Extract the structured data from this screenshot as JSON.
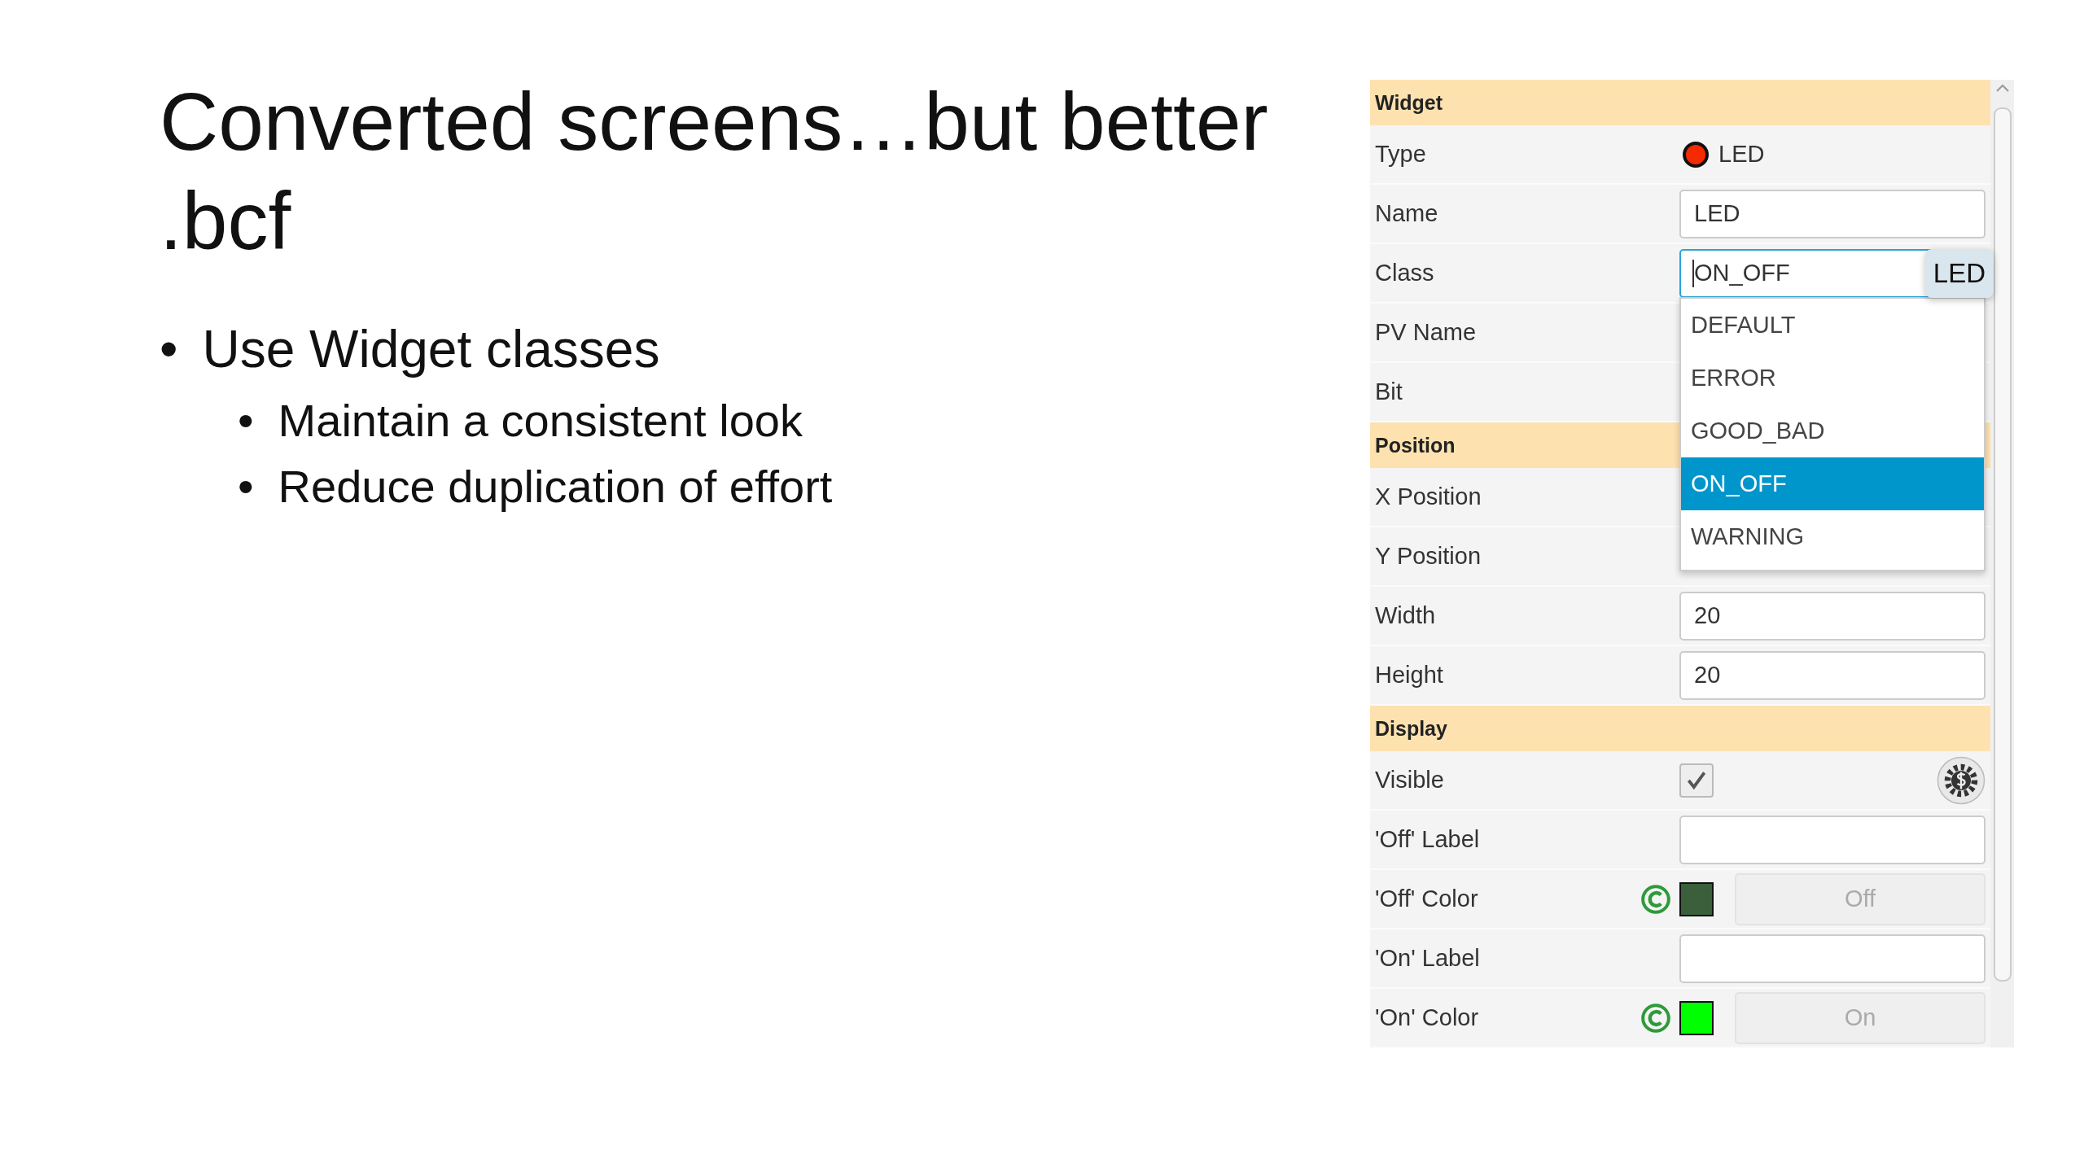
{
  "slide": {
    "title": "Converted screens…but better .bcf",
    "bullets": [
      {
        "marker": "•",
        "text": "Use Widget classes",
        "children": [
          {
            "marker": "•",
            "text": "Maintain a consistent look"
          },
          {
            "marker": "•",
            "text": "Reduce duplication of effort"
          }
        ]
      }
    ]
  },
  "properties": {
    "sections": [
      {
        "title": "Widget",
        "rows": [
          {
            "label": "Type",
            "kind": "type",
            "value": "LED"
          },
          {
            "label": "Name",
            "kind": "text",
            "value": "LED"
          },
          {
            "label": "Class",
            "kind": "combo",
            "value": "ON_OFF",
            "expanded": true,
            "tooltip": "LED",
            "options": [
              {
                "label": "DEFAULT",
                "selected": false
              },
              {
                "label": "ERROR",
                "selected": false
              },
              {
                "label": "GOOD_BAD",
                "selected": false
              },
              {
                "label": "ON_OFF",
                "selected": true
              },
              {
                "label": "WARNING",
                "selected": false
              }
            ]
          },
          {
            "label": "PV Name",
            "kind": "covered"
          },
          {
            "label": "Bit",
            "kind": "covered"
          }
        ]
      },
      {
        "title": "Position",
        "rows": [
          {
            "label": "X Position",
            "kind": "covered"
          },
          {
            "label": "Y Position",
            "kind": "covered"
          },
          {
            "label": "Width",
            "kind": "text",
            "value": "20"
          },
          {
            "label": "Height",
            "kind": "text",
            "value": "20"
          }
        ]
      },
      {
        "title": "Display",
        "rows": [
          {
            "label": "Visible",
            "kind": "checkbox",
            "checked": true
          },
          {
            "label": "'Off' Label",
            "kind": "text"
          },
          {
            "label": "'Off' Color",
            "kind": "color",
            "color": "#3a5f3a",
            "button": "Off"
          },
          {
            "label": "'On' Label",
            "kind": "text"
          },
          {
            "label": "'On' Color",
            "kind": "color",
            "color": "#00ff00",
            "button": "On"
          }
        ]
      }
    ]
  }
}
